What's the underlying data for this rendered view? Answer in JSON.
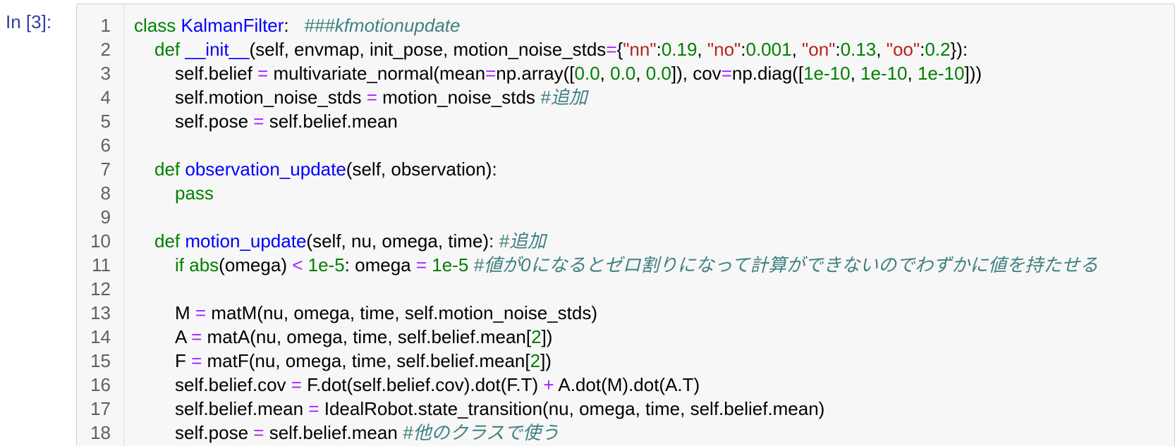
{
  "cell": {
    "prompt": "In [3]:",
    "lines": [
      {
        "n": "1",
        "indent": 0,
        "tokens": [
          {
            "t": "kw",
            "v": "class"
          },
          {
            "t": "",
            "v": " "
          },
          {
            "t": "def",
            "v": "KalmanFilter"
          },
          {
            "t": "",
            "v": ":   "
          },
          {
            "t": "cm",
            "v": "###kfmotionupdate"
          }
        ]
      },
      {
        "n": "2",
        "indent": 1,
        "tokens": [
          {
            "t": "kw",
            "v": "def"
          },
          {
            "t": "",
            "v": " "
          },
          {
            "t": "def",
            "v": "__init__"
          },
          {
            "t": "",
            "v": "(self, envmap, init_pose, motion_noise_stds"
          },
          {
            "t": "op",
            "v": "="
          },
          {
            "t": "",
            "v": "{"
          },
          {
            "t": "str",
            "v": "\"nn\""
          },
          {
            "t": "",
            "v": ":"
          },
          {
            "t": "num",
            "v": "0.19"
          },
          {
            "t": "",
            "v": ", "
          },
          {
            "t": "str",
            "v": "\"no\""
          },
          {
            "t": "",
            "v": ":"
          },
          {
            "t": "num",
            "v": "0.001"
          },
          {
            "t": "",
            "v": ", "
          },
          {
            "t": "str",
            "v": "\"on\""
          },
          {
            "t": "",
            "v": ":"
          },
          {
            "t": "num",
            "v": "0.13"
          },
          {
            "t": "",
            "v": ", "
          },
          {
            "t": "str",
            "v": "\"oo\""
          },
          {
            "t": "",
            "v": ":"
          },
          {
            "t": "num",
            "v": "0.2"
          },
          {
            "t": "",
            "v": "}):"
          }
        ]
      },
      {
        "n": "3",
        "indent": 2,
        "tokens": [
          {
            "t": "",
            "v": "self.belief "
          },
          {
            "t": "op",
            "v": "="
          },
          {
            "t": "",
            "v": " multivariate_normal(mean"
          },
          {
            "t": "op",
            "v": "="
          },
          {
            "t": "",
            "v": "np.array(["
          },
          {
            "t": "num",
            "v": "0.0"
          },
          {
            "t": "",
            "v": ", "
          },
          {
            "t": "num",
            "v": "0.0"
          },
          {
            "t": "",
            "v": ", "
          },
          {
            "t": "num",
            "v": "0.0"
          },
          {
            "t": "",
            "v": "]), cov"
          },
          {
            "t": "op",
            "v": "="
          },
          {
            "t": "",
            "v": "np.diag(["
          },
          {
            "t": "num",
            "v": "1e-10"
          },
          {
            "t": "",
            "v": ", "
          },
          {
            "t": "num",
            "v": "1e-10"
          },
          {
            "t": "",
            "v": ", "
          },
          {
            "t": "num",
            "v": "1e-10"
          },
          {
            "t": "",
            "v": "]))"
          }
        ]
      },
      {
        "n": "4",
        "indent": 2,
        "tokens": [
          {
            "t": "",
            "v": "self.motion_noise_stds "
          },
          {
            "t": "op",
            "v": "="
          },
          {
            "t": "",
            "v": " motion_noise_stds "
          },
          {
            "t": "cm",
            "v": "#追加"
          }
        ]
      },
      {
        "n": "5",
        "indent": 2,
        "tokens": [
          {
            "t": "",
            "v": "self.pose "
          },
          {
            "t": "op",
            "v": "="
          },
          {
            "t": "",
            "v": " self.belief.mean"
          }
        ]
      },
      {
        "n": "6",
        "indent": 0,
        "tokens": []
      },
      {
        "n": "7",
        "indent": 1,
        "tokens": [
          {
            "t": "kw",
            "v": "def"
          },
          {
            "t": "",
            "v": " "
          },
          {
            "t": "def",
            "v": "observation_update"
          },
          {
            "t": "",
            "v": "(self, observation):"
          }
        ]
      },
      {
        "n": "8",
        "indent": 2,
        "tokens": [
          {
            "t": "kw",
            "v": "pass"
          }
        ]
      },
      {
        "n": "9",
        "indent": 0,
        "tokens": []
      },
      {
        "n": "10",
        "indent": 1,
        "tokens": [
          {
            "t": "kw",
            "v": "def"
          },
          {
            "t": "",
            "v": " "
          },
          {
            "t": "def",
            "v": "motion_update"
          },
          {
            "t": "",
            "v": "(self, nu, omega, time): "
          },
          {
            "t": "cm",
            "v": "#追加"
          }
        ]
      },
      {
        "n": "11",
        "indent": 2,
        "tokens": [
          {
            "t": "kw",
            "v": "if"
          },
          {
            "t": "",
            "v": " "
          },
          {
            "t": "kw",
            "v": "abs"
          },
          {
            "t": "",
            "v": "(omega) "
          },
          {
            "t": "op",
            "v": "<"
          },
          {
            "t": "",
            "v": " "
          },
          {
            "t": "num",
            "v": "1e-5"
          },
          {
            "t": "",
            "v": ": omega "
          },
          {
            "t": "op",
            "v": "="
          },
          {
            "t": "",
            "v": " "
          },
          {
            "t": "num",
            "v": "1e-5"
          },
          {
            "t": "",
            "v": " "
          },
          {
            "t": "cm",
            "v": "#値が0になるとゼロ割りになって計算ができないのでわずかに値を持たせる"
          }
        ]
      },
      {
        "n": "12",
        "indent": 0,
        "tokens": []
      },
      {
        "n": "13",
        "indent": 2,
        "tokens": [
          {
            "t": "",
            "v": "M "
          },
          {
            "t": "op",
            "v": "="
          },
          {
            "t": "",
            "v": " matM(nu, omega, time, self.motion_noise_stds)"
          }
        ]
      },
      {
        "n": "14",
        "indent": 2,
        "tokens": [
          {
            "t": "",
            "v": "A "
          },
          {
            "t": "op",
            "v": "="
          },
          {
            "t": "",
            "v": " matA(nu, omega, time, self.belief.mean["
          },
          {
            "t": "num",
            "v": "2"
          },
          {
            "t": "",
            "v": "])"
          }
        ]
      },
      {
        "n": "15",
        "indent": 2,
        "tokens": [
          {
            "t": "",
            "v": "F "
          },
          {
            "t": "op",
            "v": "="
          },
          {
            "t": "",
            "v": " matF(nu, omega, time, self.belief.mean["
          },
          {
            "t": "num",
            "v": "2"
          },
          {
            "t": "",
            "v": "])"
          }
        ]
      },
      {
        "n": "16",
        "indent": 2,
        "tokens": [
          {
            "t": "",
            "v": "self.belief.cov "
          },
          {
            "t": "op",
            "v": "="
          },
          {
            "t": "",
            "v": " F.dot(self.belief.cov).dot(F.T) "
          },
          {
            "t": "op",
            "v": "+"
          },
          {
            "t": "",
            "v": " A.dot(M).dot(A.T)"
          }
        ]
      },
      {
        "n": "17",
        "indent": 2,
        "tokens": [
          {
            "t": "",
            "v": "self.belief.mean "
          },
          {
            "t": "op",
            "v": "="
          },
          {
            "t": "",
            "v": " IdealRobot.state_transition(nu, omega, time, self.belief.mean)"
          }
        ]
      },
      {
        "n": "18",
        "indent": 2,
        "tokens": [
          {
            "t": "",
            "v": "self.pose "
          },
          {
            "t": "op",
            "v": "="
          },
          {
            "t": "",
            "v": " self.belief.mean "
          },
          {
            "t": "cm",
            "v": "#他のクラスで使う"
          }
        ]
      }
    ]
  },
  "colors": {
    "prompt": "#303f9f",
    "keyword": "#008000",
    "definition": "#0000ff",
    "operator": "#aa22ff",
    "number": "#008000",
    "string": "#ba2121",
    "comment": "#408080",
    "cell_background": "#f7f7f7"
  }
}
